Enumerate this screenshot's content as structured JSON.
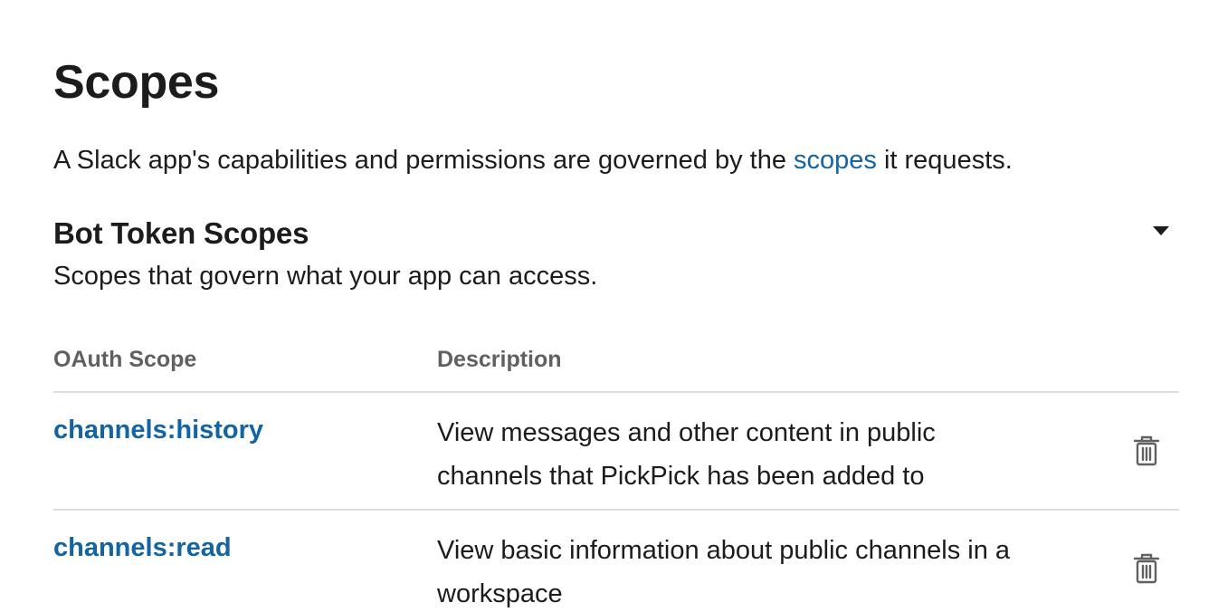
{
  "page": {
    "title": "Scopes",
    "intro_before": "A Slack app's capabilities and permissions are governed by the ",
    "intro_link": "scopes",
    "intro_after": " it requests."
  },
  "bot_scopes": {
    "title": "Bot Token Scopes",
    "description": "Scopes that govern what your app can access.",
    "collapse_icon": "caret-down-icon",
    "columns": {
      "scope": "OAuth Scope",
      "description": "Description"
    },
    "rows": [
      {
        "scope": "channels:history",
        "description": "View messages and other content in public channels that PickPick has been added to",
        "action_icon": "trash-icon"
      },
      {
        "scope": "channels:read",
        "description": "View basic information about public channels in a workspace",
        "action_icon": "trash-icon"
      }
    ]
  },
  "colors": {
    "link": "#1264a3",
    "text": "#1d1c1d",
    "muted": "#616061",
    "divider": "#dddddd"
  }
}
